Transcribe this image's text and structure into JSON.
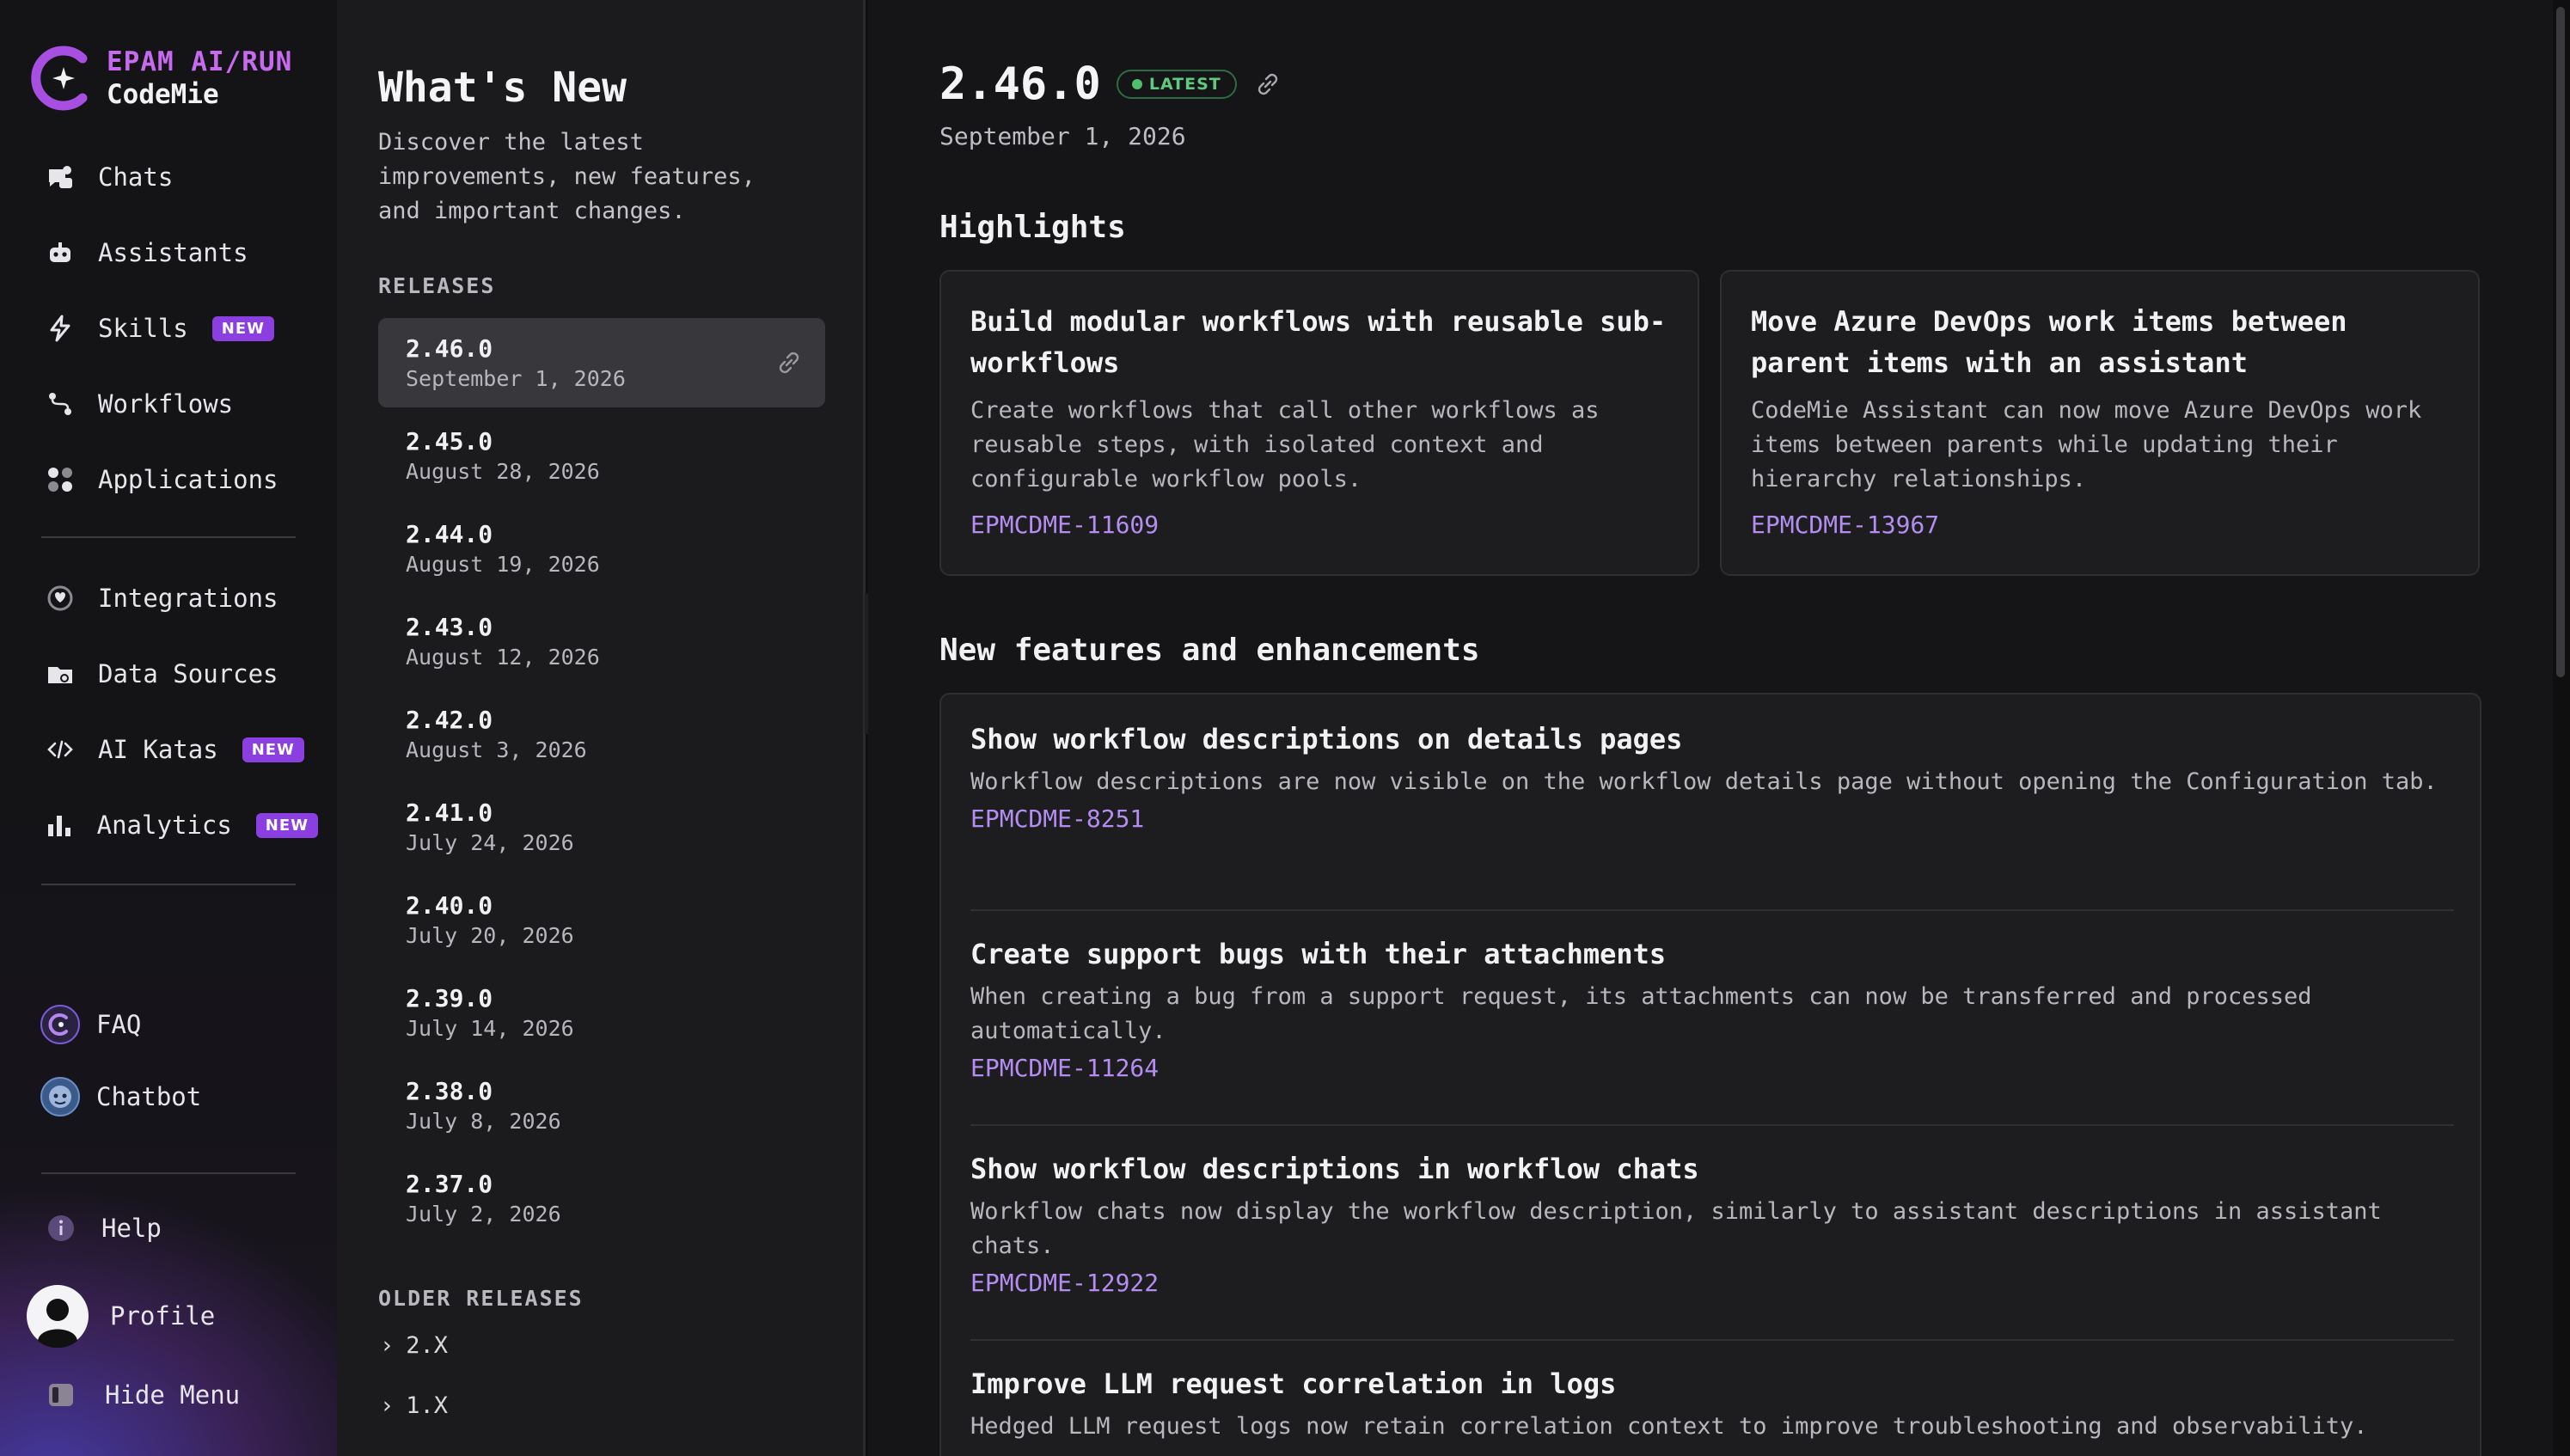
{
  "brand": {
    "line1": "EPAM AI/RUN",
    "line2": "CodeMie"
  },
  "nav": {
    "items": [
      {
        "label": "Chats",
        "icon": "chats-icon"
      },
      {
        "label": "Assistants",
        "icon": "robot-icon"
      },
      {
        "label": "Skills",
        "icon": "bolt-icon",
        "badge": "NEW"
      },
      {
        "label": "Workflows",
        "icon": "workflow-icon"
      },
      {
        "label": "Applications",
        "icon": "apps-icon"
      },
      {
        "label": "Integrations",
        "icon": "plug-icon"
      },
      {
        "label": "Data Sources",
        "icon": "database-icon"
      },
      {
        "label": "AI Katas",
        "icon": "code-icon",
        "badge": "NEW"
      },
      {
        "label": "Analytics",
        "icon": "bar-chart-icon",
        "badge": "NEW"
      }
    ],
    "faq": "FAQ",
    "chatbot": "Chatbot",
    "help": "Help",
    "profile": "Profile",
    "hide_menu": "Hide Menu"
  },
  "releases_panel": {
    "title": "What's New",
    "subtitle": "Discover the latest improvements, new features, and important changes.",
    "releases_label": "RELEASES",
    "releases": [
      {
        "version": "2.46.0",
        "date": "September 1, 2026"
      },
      {
        "version": "2.45.0",
        "date": "August 28, 2026"
      },
      {
        "version": "2.44.0",
        "date": "August 19, 2026"
      },
      {
        "version": "2.43.0",
        "date": "August 12, 2026"
      },
      {
        "version": "2.42.0",
        "date": "August 3, 2026"
      },
      {
        "version": "2.41.0",
        "date": "July 24, 2026"
      },
      {
        "version": "2.40.0",
        "date": "July 20, 2026"
      },
      {
        "version": "2.39.0",
        "date": "July 14, 2026"
      },
      {
        "version": "2.38.0",
        "date": "July 8, 2026"
      },
      {
        "version": "2.37.0",
        "date": "July 2, 2026"
      }
    ],
    "older_label": "OLDER RELEASES",
    "older": [
      "2.X",
      "1.X"
    ]
  },
  "main": {
    "version": "2.46.0",
    "latest_badge": "LATEST",
    "date": "September 1, 2026",
    "highlights_heading": "Highlights",
    "highlights": [
      {
        "title": "Build modular workflows with reusable sub-workflows",
        "desc": "Create workflows that call other workflows as reusable steps, with isolated context and configurable workflow pools.",
        "ticket": "EPMCDME-11609"
      },
      {
        "title": "Move Azure DevOps work items between parent items with an assistant",
        "desc": "CodeMie Assistant can now move Azure DevOps work items between parents while updating their hierarchy relationships.",
        "ticket": "EPMCDME-13967"
      }
    ],
    "features_heading": "New features and enhancements",
    "features": [
      {
        "title": "Show workflow descriptions on details pages",
        "desc": "Workflow descriptions are now visible on the workflow details page without opening the Configuration tab.",
        "ticket": "EPMCDME-8251"
      },
      {
        "title": "Create support bugs with their attachments",
        "desc": "When creating a bug from a support request, its attachments can now be transferred and processed automatically.",
        "ticket": "EPMCDME-11264"
      },
      {
        "title": "Show workflow descriptions in workflow chats",
        "desc": "Workflow chats now display the workflow description, similarly to assistant descriptions in assistant chats.",
        "ticket": "EPMCDME-12922"
      },
      {
        "title": "Improve LLM request correlation in logs",
        "desc": "Hedged LLM request logs now retain correlation context to improve troubleshooting and observability.",
        "ticket": ""
      }
    ]
  },
  "colors": {
    "accent": "#b38ef0",
    "badge": "#8b3fe0",
    "latest": "#5fc97f"
  }
}
